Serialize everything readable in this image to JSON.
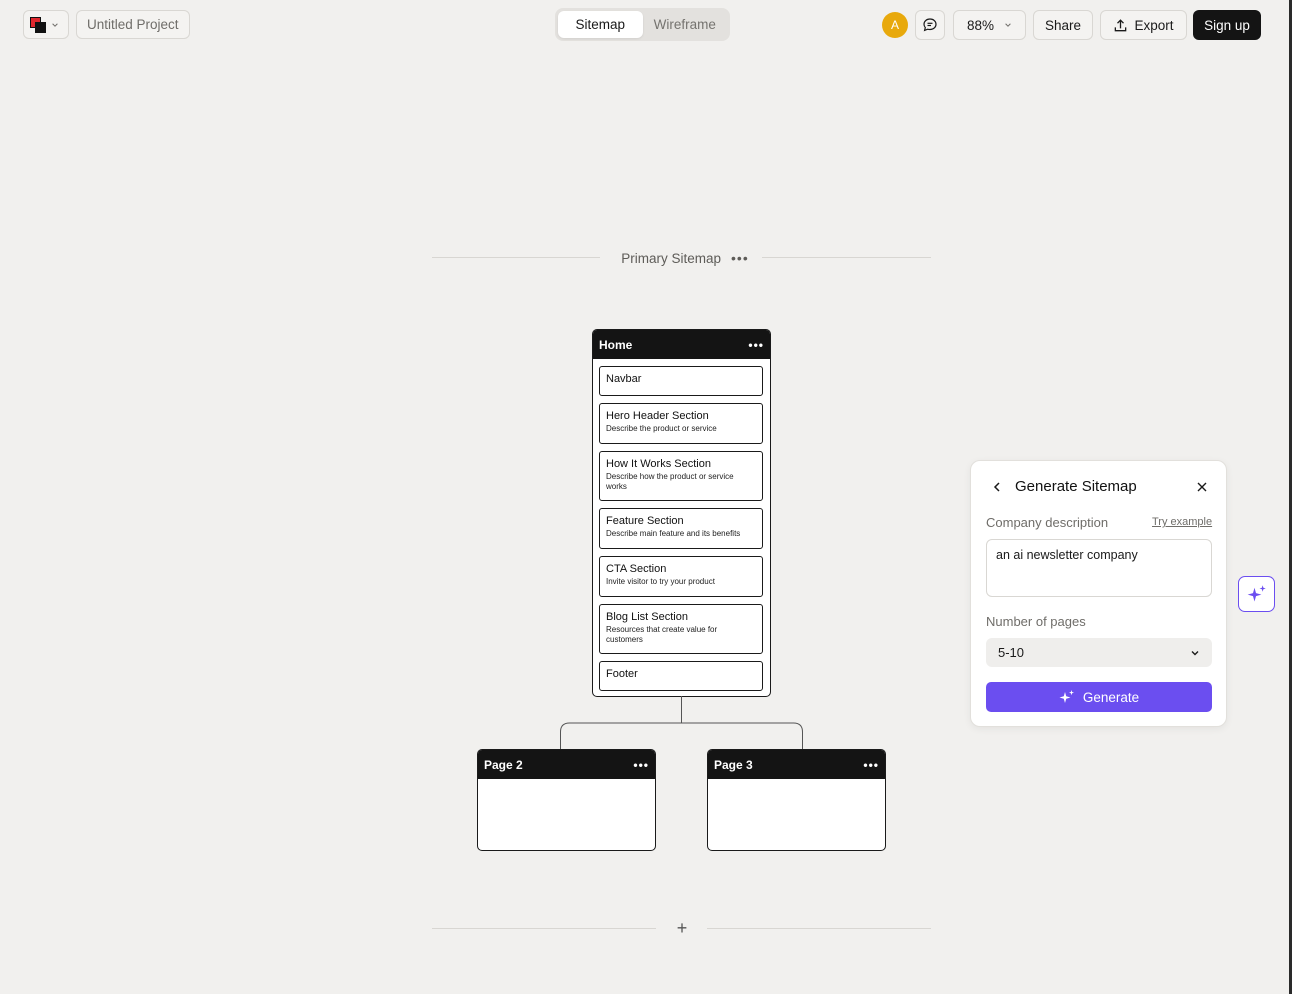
{
  "topbar": {
    "project_name": "Untitled Project",
    "tabs": [
      {
        "label": "Sitemap",
        "active": true
      },
      {
        "label": "Wireframe",
        "active": false
      }
    ],
    "avatar_initial": "A",
    "zoom": "88%",
    "share_label": "Share",
    "export_label": "Export",
    "signup_label": "Sign up"
  },
  "sitemap": {
    "title": "Primary Sitemap",
    "home": {
      "title": "Home",
      "sections": [
        {
          "title": "Navbar",
          "desc": ""
        },
        {
          "title": "Hero Header Section",
          "desc": "Describe the product or service"
        },
        {
          "title": "How It Works Section",
          "desc": "Describe how the product or service works"
        },
        {
          "title": "Feature Section",
          "desc": "Describe main feature and its benefits"
        },
        {
          "title": "CTA Section",
          "desc": "Invite visitor to try your product"
        },
        {
          "title": "Blog List Section",
          "desc": "Resources that create value for customers"
        },
        {
          "title": "Footer",
          "desc": ""
        }
      ]
    },
    "children": [
      {
        "title": "Page 2"
      },
      {
        "title": "Page 3"
      }
    ],
    "add_symbol": "+"
  },
  "panel": {
    "title": "Generate Sitemap",
    "company_label": "Company description",
    "try_example": "Try example",
    "company_value": "an ai newsletter company",
    "pages_label": "Number of pages",
    "pages_value": "5-10",
    "generate_label": "Generate"
  },
  "colors": {
    "accent": "#6b4ef0",
    "avatar": "#e8a90c",
    "background": "#f1f0ee",
    "card_header": "#141414"
  }
}
